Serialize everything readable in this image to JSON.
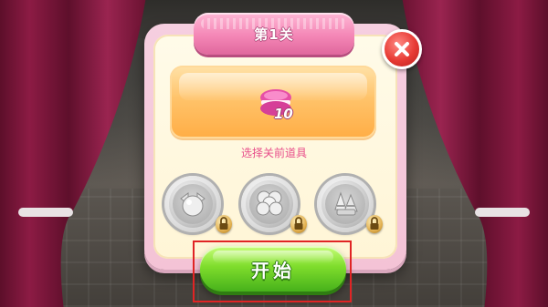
{
  "dialog": {
    "title": "第1关",
    "reward": {
      "icon": "macaron-icon",
      "count": "10"
    },
    "subtitle": "选择关前道具",
    "boosters": [
      {
        "icon": "bomb-candy-icon",
        "locked": true
      },
      {
        "icon": "cookie-cluster-icon",
        "locked": true
      },
      {
        "icon": "striped-candy-icon",
        "locked": true
      }
    ],
    "start_label": "开始",
    "close_icon": "close-icon"
  },
  "colors": {
    "banner": "#f487b6",
    "panel_border": "#f4c3d6",
    "reward_bar": "#ffc36a",
    "subtitle": "#e84f8b",
    "start_button": "#7fdd2c",
    "close_button": "#e73a34",
    "curtain": "#7a1436",
    "highlight": "#e02424"
  }
}
